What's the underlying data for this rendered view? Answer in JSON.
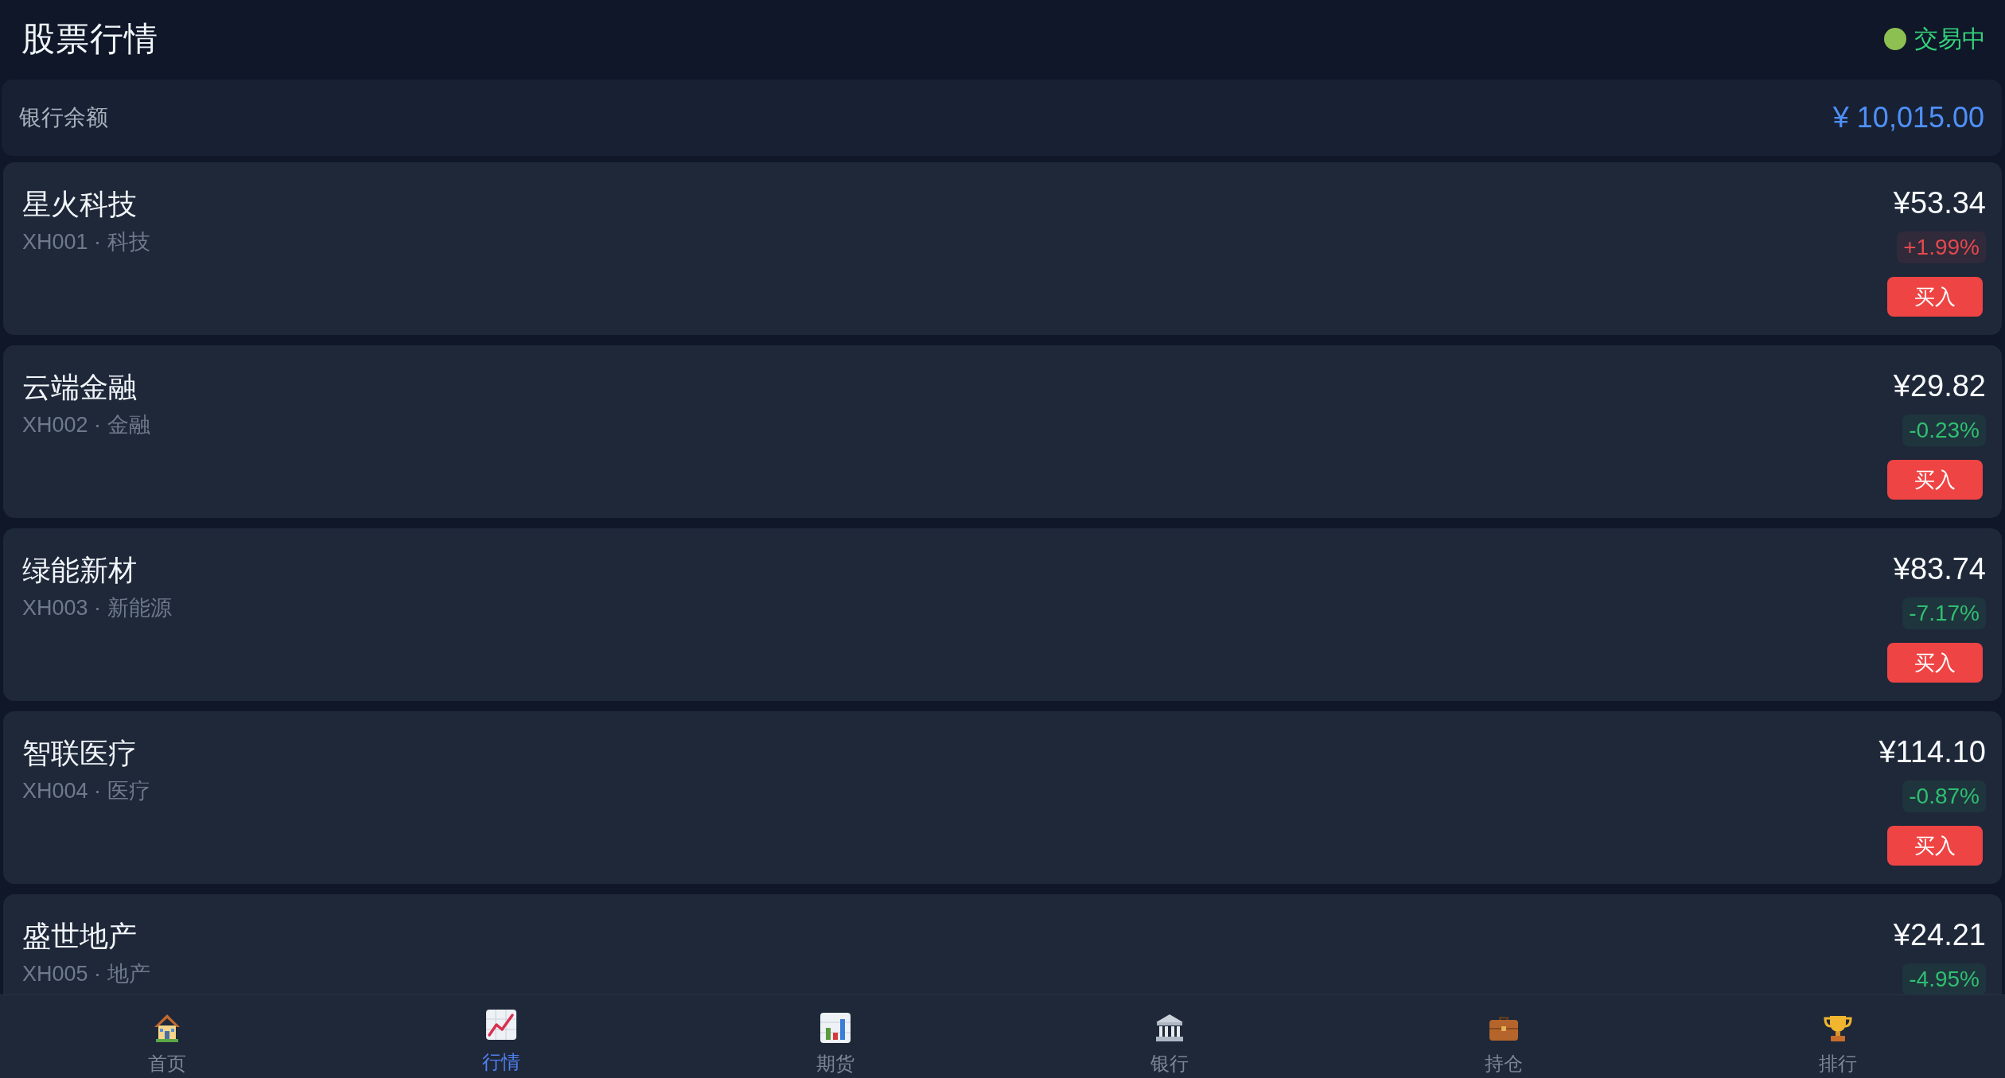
{
  "header": {
    "title": "股票行情",
    "status": {
      "label": "交易中",
      "open": true
    }
  },
  "balance": {
    "label": "银行余额",
    "amount": "¥ 10,015.00"
  },
  "stocks": [
    {
      "name": "星火科技",
      "meta": "XH001 · 科技",
      "price": "¥53.34",
      "change": "+1.99%",
      "kind": "up",
      "action": "买入"
    },
    {
      "name": "云端金融",
      "meta": "XH002 · 金融",
      "price": "¥29.82",
      "change": "-0.23%",
      "kind": "down",
      "action": "买入"
    },
    {
      "name": "绿能新材",
      "meta": "XH003 · 新能源",
      "price": "¥83.74",
      "change": "-7.17%",
      "kind": "down",
      "action": "买入"
    },
    {
      "name": "智联医疗",
      "meta": "XH004 · 医疗",
      "price": "¥114.10",
      "change": "-0.87%",
      "kind": "down",
      "action": "买入"
    },
    {
      "name": "盛世地产",
      "meta": "XH005 · 地产",
      "price": "¥24.21",
      "change": "-4.95%",
      "kind": "down"
    }
  ],
  "nav": {
    "items": [
      {
        "label": "首页",
        "selected": false
      },
      {
        "label": "行情",
        "selected": true
      },
      {
        "label": "期货",
        "selected": false
      },
      {
        "label": "银行",
        "selected": false
      },
      {
        "label": "持仓",
        "selected": false
      },
      {
        "label": "排行",
        "selected": false
      }
    ]
  }
}
